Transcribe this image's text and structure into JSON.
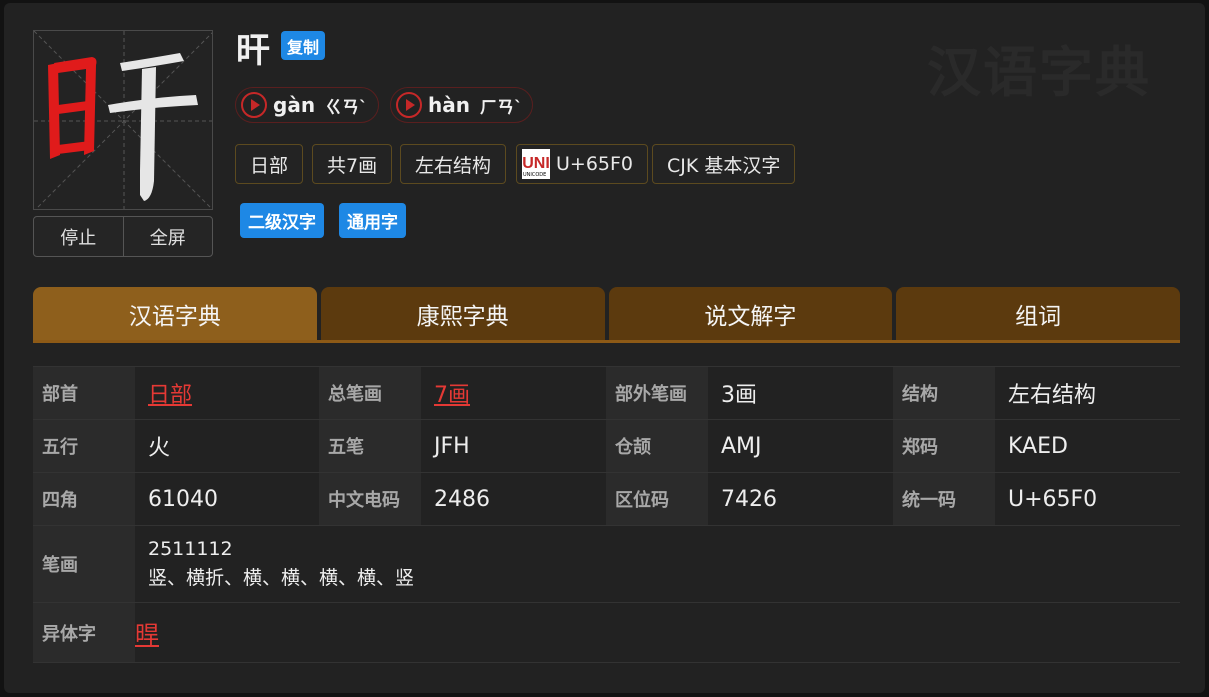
{
  "watermark": "汉语字典",
  "char": "旰",
  "copy_label": "复制",
  "controls": {
    "stop": "停止",
    "fullscreen": "全屏"
  },
  "pinyins": [
    {
      "py": "gàn",
      "zhuyin": "ㄍㄢˋ"
    },
    {
      "py": "hàn",
      "zhuyin": "ㄏㄢˋ"
    }
  ],
  "tags": {
    "radical": "日部",
    "strokes": "共7画",
    "structure": "左右结构",
    "unicode": "U+65F0",
    "block": "CJK 基本汉字",
    "unicode_logo": "UNICODE"
  },
  "badges": [
    "二级汉字",
    "通用字"
  ],
  "tabs": [
    "汉语字典",
    "康熙字典",
    "说文解字",
    "组词"
  ],
  "info": {
    "rows": [
      [
        {
          "k": "部首",
          "v": "日部",
          "link": true
        },
        {
          "k": "总笔画",
          "v": "7画",
          "link": true
        },
        {
          "k": "部外笔画",
          "v": "3画"
        },
        {
          "k": "结构",
          "v": "左右结构"
        }
      ],
      [
        {
          "k": "五行",
          "v": "火"
        },
        {
          "k": "五笔",
          "v": "JFH"
        },
        {
          "k": "仓颉",
          "v": "AMJ"
        },
        {
          "k": "郑码",
          "v": "KAED"
        }
      ],
      [
        {
          "k": "四角",
          "v": "61040"
        },
        {
          "k": "中文电码",
          "v": "2486"
        },
        {
          "k": "区位码",
          "v": "7426"
        },
        {
          "k": "统一码",
          "v": "U+65F0"
        }
      ]
    ],
    "strokes_label": "笔画",
    "strokes_code": "2511112",
    "strokes_names": "竖、横折、横、横、横、横、竖",
    "variant_label": "异体字",
    "variant_value": "晘"
  },
  "colors": {
    "accent": "#1e88e5",
    "tab_active": "#8e5f1c",
    "tab": "#5c3a0e",
    "link": "#e53935",
    "stroke_red": "#e01b1b"
  }
}
